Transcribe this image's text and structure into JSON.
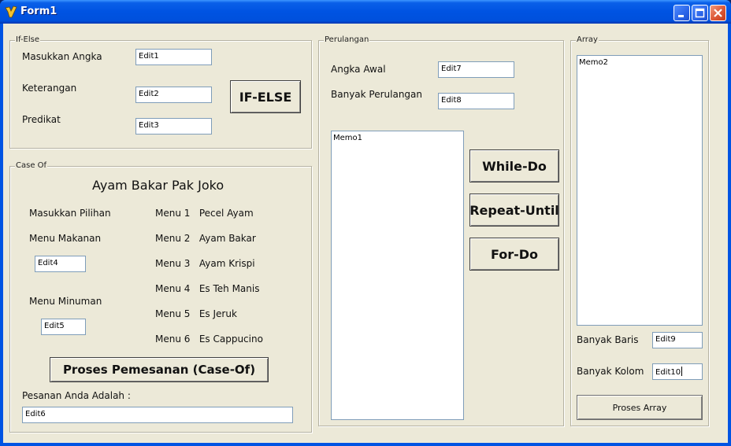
{
  "window": {
    "title": "Form1"
  },
  "ifelse": {
    "caption": "If-Else",
    "label_angka": "Masukkan Angka",
    "label_keterangan": "Keterangan",
    "label_predikat": "Predikat",
    "edit1": "Edit1",
    "edit2": "Edit2",
    "edit3": "Edit3",
    "button": "IF-ELSE"
  },
  "caseof": {
    "caption": "Case Of",
    "heading": "Ayam Bakar Pak Joko",
    "label_pilihan": "Masukkan Pilihan",
    "label_makanan": "Menu Makanan",
    "label_minuman": "Menu Minuman",
    "edit4": "Edit4",
    "edit5": "Edit5",
    "menu": [
      "Menu 1   Pecel Ayam",
      "Menu 2   Ayam Bakar",
      "Menu 3   Ayam Krispi",
      "Menu 4   Es Teh Manis",
      "Menu 5   Es Jeruk",
      "Menu 6   Es Cappucino"
    ],
    "button": "Proses Pemesanan (Case-Of)",
    "label_pesanan": "Pesanan Anda Adalah :",
    "edit6": "Edit6"
  },
  "loop": {
    "caption": "Perulangan",
    "label_awal": "Angka Awal",
    "label_banyak": "Banyak Perulangan",
    "edit7": "Edit7",
    "edit8": "Edit8",
    "memo1": "Memo1",
    "btn_while": "While-Do",
    "btn_repeat": "Repeat-Until",
    "btn_for": "For-Do"
  },
  "array": {
    "caption": "Array",
    "memo2": "Memo2",
    "label_baris": "Banyak Baris",
    "label_kolom": "Banyak Kolom",
    "edit9": "Edit9",
    "edit10": "Edit10",
    "button": "Proses Array"
  }
}
